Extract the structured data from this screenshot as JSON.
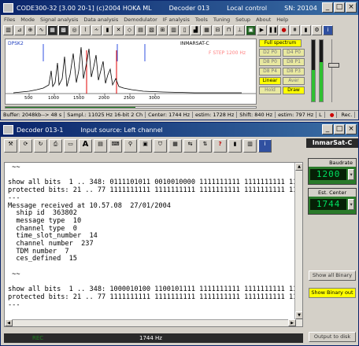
{
  "main_window": {
    "title": "CODE300-32 [3.00 20-1] (c)2004 HOKA ML",
    "title_decoder": "Decoder 013",
    "title_control": "Local control",
    "title_sn": "SN: 20104",
    "menu": [
      "Files",
      "Mode",
      "Signal analysis",
      "Data analysis",
      "Demodulator",
      "IF analysis",
      "Tools",
      "Tuning",
      "Setup",
      "About",
      "Help"
    ],
    "spectrum": {
      "label_left": "DPSK2",
      "label_center": "INMARSAT-C",
      "label_red": "F STEP 1200 Hz",
      "freq_ticks": [
        "500",
        "1000",
        "1500",
        "2000",
        "2500",
        "3000"
      ]
    },
    "side_buttons": {
      "full_spectrum": "Full spectrum",
      "d2_p0": "D2 P0",
      "d4_p0": "D4 P0",
      "d8_p0": "D8 P0",
      "d8_p1": "D8 P1",
      "d8_p4": "D8 P4",
      "d8_p3": "D8 P3",
      "linear": "Linear",
      "aver": "Aver",
      "hold": "Hold",
      "draw": "Draw"
    },
    "status": {
      "buffer": "Buffer: 2048kb--> 48 s",
      "sampl": "Sampl.: 11025 Hz 16-bit 2 Ch",
      "center": "Center: 1744 Hz",
      "estim1": "estim: 1728 Hz",
      "shift": "Shift: 840 Hz",
      "estim2": "estim: 797 Hz",
      "channel": "L",
      "rec": "Rec."
    }
  },
  "decoder_window": {
    "title": "Decoder 013-1",
    "input_source": "Input source: Left channel",
    "mode_title": "InmarSat-C",
    "baudrate_label": "Baudrate",
    "baudrate_value": "1200",
    "est_center_label": "Est. Center",
    "est_center_value": "1744",
    "show_all_binary": "Show all Binary",
    "show_binary_out": "Show Binary out",
    "output_to_disk": "Output to disk",
    "status_center": "1744 Hz",
    "status_left": "REC",
    "text_lines": [
      " ~~",
      "",
      "show all bits  1 .. 348: 0111101011 0010010000 1111111111 1111111111 1111",
      "protected bits: 21 .. 77 1111111111 1111111111 1111111111 1111111111 1111",
      "---",
      "Message received at 10.57.08  27/01/2004",
      "  ship id  363802",
      "  message type  10",
      "  channel type  0",
      "  time_slot_number  14",
      "  channel number  237",
      "  TDM number  7",
      "  ces_defined  15",
      "",
      " ~~",
      "",
      "show all bits  1 .. 348: 1000010100 1100101111 1111111111 1111111111 1111",
      "protected bits: 21 .. 77 1111111111 1111111111 1111111111 1111111111 1111",
      "---"
    ]
  }
}
